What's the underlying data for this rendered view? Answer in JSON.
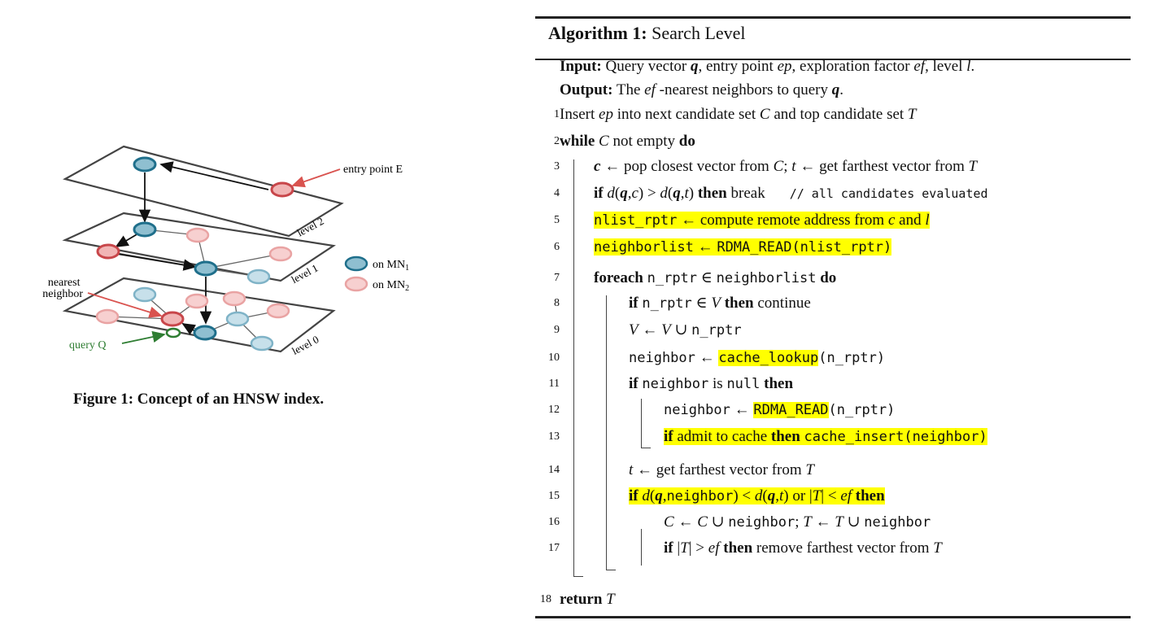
{
  "figure": {
    "labels": {
      "entry_point": "entry point E",
      "level2": "level 2",
      "level1": "level 1",
      "level0": "level 0",
      "nearest_neighbor": [
        "nearest",
        "neighbor"
      ],
      "query": "query Q",
      "legend_mn1": "on MN",
      "legend_mn1_sub": "1",
      "legend_mn2": "on MN",
      "legend_mn2_sub": "2"
    },
    "caption": "Figure 1: Concept of an HNSW index.",
    "colors": {
      "blue": "#1f6f8b",
      "blue_light": "#8fbfd0",
      "red": "#c8464a",
      "red_light": "#f1b5b5",
      "query_green": "#2e7d32"
    }
  },
  "algorithm": {
    "title_bold": "Algorithm 1:",
    "title_rest": " Search Level",
    "input_label": "Input:",
    "input_text": [
      " Query vector ",
      "q",
      ", entry point ",
      "ep",
      ", exploration factor ",
      "ef",
      ", level ",
      "l",
      "."
    ],
    "output_label": "Output:",
    "output_text": [
      " The ",
      "ef",
      " -nearest neighbors to query ",
      "q",
      "."
    ],
    "line_numbers": [
      "1",
      "2",
      "3",
      "4",
      "5",
      "6",
      "7",
      "8",
      "9",
      "10",
      "11",
      "12",
      "13",
      "14",
      "15",
      "16",
      "17",
      "18"
    ],
    "l1": [
      "Insert ",
      "ep",
      " into next candidate set ",
      "C",
      " and top candidate set ",
      "T"
    ],
    "l2": [
      "while",
      " ",
      "C",
      " not empty ",
      "do"
    ],
    "l3": [
      "c",
      " ← pop closest vector from ",
      "C",
      "; ",
      "t",
      " ← get farthest vector from ",
      "T"
    ],
    "l4": [
      "if",
      " ",
      "d",
      "(",
      "q",
      ",",
      "c",
      ") > ",
      "d",
      "(",
      "q",
      ",",
      "t",
      ") ",
      "then",
      " break",
      "// all candidates evaluated"
    ],
    "l5": [
      "nlist_rptr",
      " ← compute remote address from ",
      "c",
      " and ",
      "l"
    ],
    "l6": [
      "neighborlist",
      " ← ",
      "RDMA_READ(nlist_rptr)"
    ],
    "l7": [
      "foreach",
      " ",
      "n_rptr",
      " ∈ ",
      "neighborlist",
      " ",
      "do"
    ],
    "l8": [
      "if",
      " ",
      "n_rptr",
      " ∈ ",
      "V",
      " ",
      "then",
      " continue"
    ],
    "l9": [
      "V",
      " ← ",
      "V",
      " ∪ ",
      "n_rptr"
    ],
    "l10": [
      "neighbor",
      " ← ",
      "cache_lookup",
      "(n_rptr)"
    ],
    "l11": [
      "if",
      " ",
      "neighbor",
      " is ",
      "null",
      " ",
      "then"
    ],
    "l12": [
      "neighbor",
      " ← ",
      "RDMA_READ",
      "(n_rptr)"
    ],
    "l13": [
      "if",
      " admit to cache ",
      "then",
      " ",
      "cache_insert(neighbor)"
    ],
    "l14": [
      "t",
      " ← get farthest vector from ",
      "T"
    ],
    "l15": [
      "if",
      " ",
      "d",
      "(",
      "q",
      ",",
      "neighbor",
      ") < ",
      "d",
      "(",
      "q",
      ",",
      "t",
      ")",
      " or ",
      "|",
      "T",
      "| < ",
      "ef",
      " ",
      "then"
    ],
    "l16": [
      "C",
      " ← ",
      "C",
      " ∪ ",
      "neighbor",
      "; ",
      "T",
      " ← ",
      "T",
      " ∪ ",
      "neighbor"
    ],
    "l17": [
      "if",
      " |",
      "T",
      "| > ",
      "ef",
      " ",
      "then",
      " remove farthest vector from ",
      "T"
    ],
    "l18": [
      "return",
      " ",
      "T"
    ]
  },
  "highlight_color": "#ffff00"
}
